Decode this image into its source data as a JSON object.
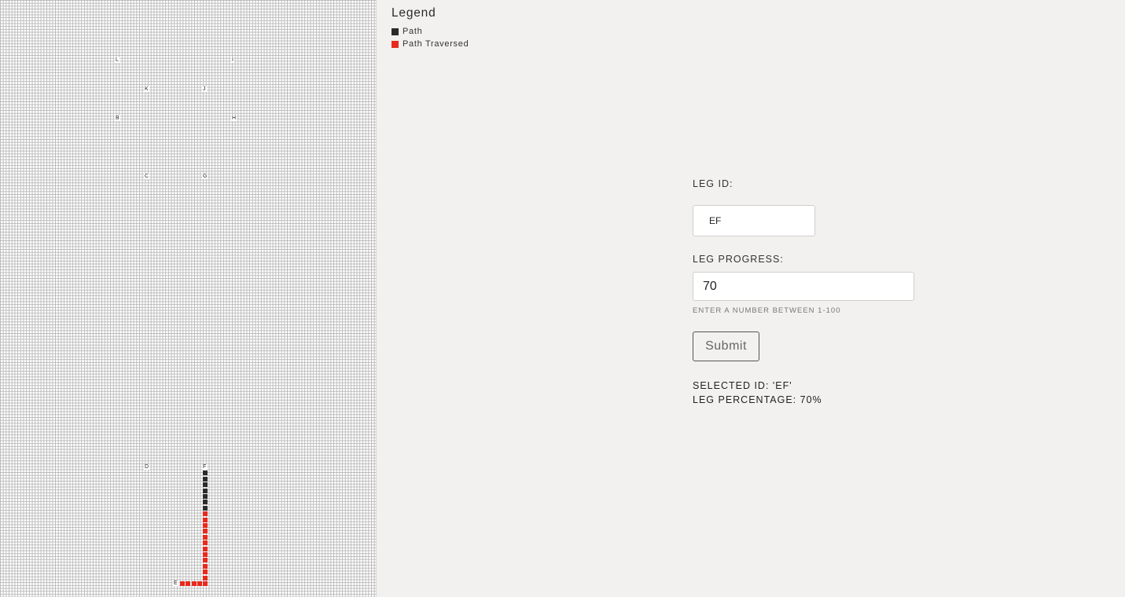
{
  "grid": {
    "nodes": [
      "L",
      "I",
      "K",
      "J",
      "B",
      "H",
      "C",
      "G",
      "D",
      "F",
      "E"
    ]
  },
  "route": {
    "leg": "EF",
    "progress_percent": 70,
    "traversed_color": "#e8291c",
    "path_color": "#2b2b2b"
  },
  "legend": {
    "title": "Legend",
    "items": [
      {
        "label": "Path",
        "color": "#2b2b2b"
      },
      {
        "label": "Path Traversed",
        "color": "#e8291c"
      }
    ]
  },
  "form": {
    "leg_id_label": "LEG ID:",
    "leg_id_value": "EF",
    "progress_label": "LEG PROGRESS:",
    "progress_value": "70",
    "helper_text": "ENTER A NUMBER BETWEEN 1-100",
    "submit_label": "Submit"
  },
  "status": {
    "selected_id": "SELECTED ID: 'EF'",
    "leg_percentage": "LEG PERCENTAGE: 70%"
  }
}
